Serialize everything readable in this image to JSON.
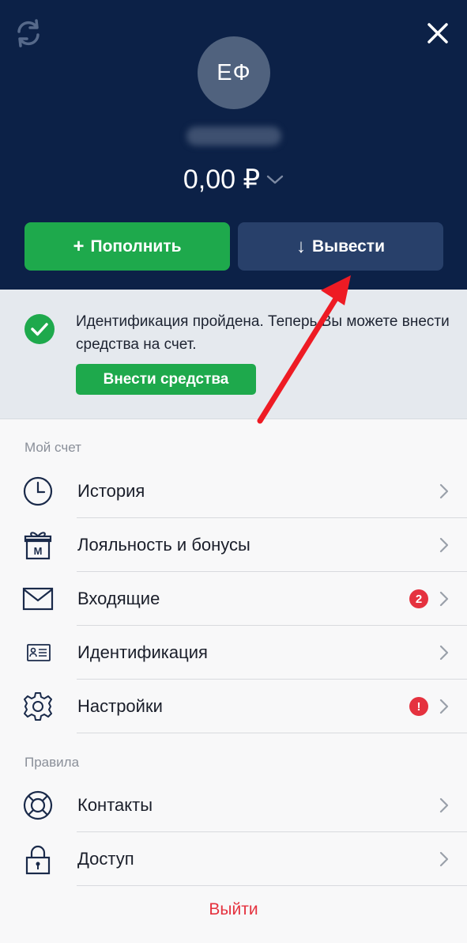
{
  "header": {
    "avatar_initials": "ЕФ",
    "balance": "0,00 ₽",
    "deposit_label": "Пополнить",
    "withdraw_label": "Вывести"
  },
  "notice": {
    "text": "Идентификация пройдена. Теперь Вы можете внести средства на счет.",
    "button_label": "Внести средства"
  },
  "menu": {
    "account_section": "Мой счет",
    "items": [
      {
        "label": "История",
        "icon": "clock-icon"
      },
      {
        "label": "Лояльность и бонусы",
        "icon": "gift-icon"
      },
      {
        "label": "Входящие",
        "icon": "envelope-icon",
        "badge": "2"
      },
      {
        "label": "Идентификация",
        "icon": "id-card-icon"
      },
      {
        "label": "Настройки",
        "icon": "gear-icon",
        "badge": "!"
      }
    ],
    "rules_section": "Правила",
    "rules_items": [
      {
        "label": "Контакты",
        "icon": "lifebuoy-icon"
      },
      {
        "label": "Доступ",
        "icon": "padlock-icon"
      }
    ],
    "logout_label": "Выйти"
  },
  "colors": {
    "header_bg": "#0c2147",
    "accent_green": "#1ea94c",
    "withdraw_btn": "#28406a",
    "badge_red": "#e5323f",
    "arrow_red": "#ee1b24"
  }
}
